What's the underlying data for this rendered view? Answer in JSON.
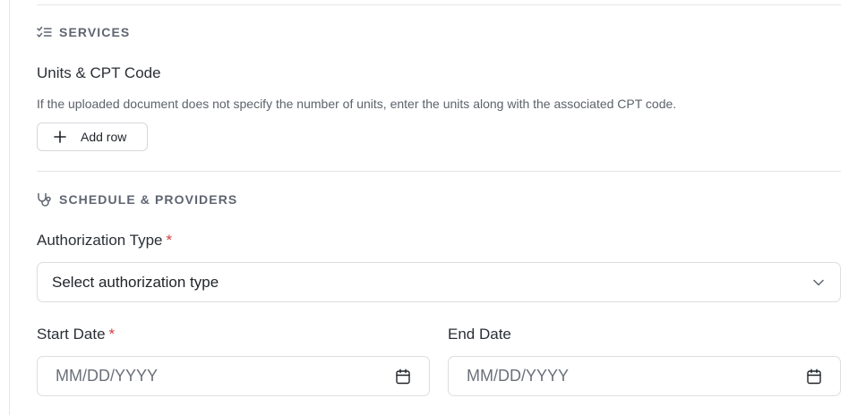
{
  "services": {
    "header": "SERVICES",
    "icon": "list-check-icon",
    "field_title": "Units & CPT Code",
    "help_text": "If the uploaded document does not specify the number of units, enter the units along with the associated CPT code.",
    "add_row_label": "Add row"
  },
  "schedule": {
    "header": "SCHEDULE & PROVIDERS",
    "icon": "stethoscope-icon",
    "authorization_type": {
      "label": "Authorization Type",
      "required_mark": "*",
      "selected_text": "Select authorization type"
    },
    "start_date": {
      "label": "Start Date",
      "required_mark": "*",
      "placeholder": "MM/DD/YYYY",
      "value": ""
    },
    "end_date": {
      "label": "End Date",
      "placeholder": "MM/DD/YYYY",
      "value": ""
    }
  },
  "colors": {
    "required": "#d83b3b",
    "muted_text": "#5f6570",
    "border": "#dcdee2"
  }
}
